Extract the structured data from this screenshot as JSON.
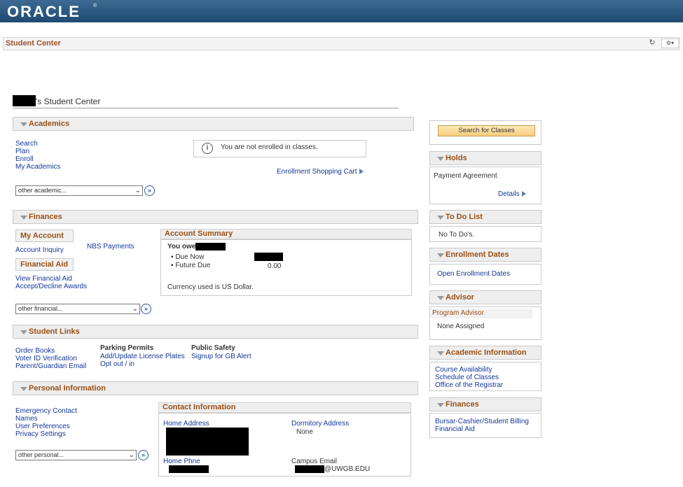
{
  "brand": {
    "logo": "ORACLE",
    "logo_mark": "®"
  },
  "page": {
    "title": "Student Center",
    "student_center_suffix": "'s Student Center"
  },
  "icons": {
    "refresh": "refresh-icon",
    "gear": "gear-icon"
  },
  "academics": {
    "header": "Academics",
    "links": [
      "Search",
      "Plan",
      "Enroll",
      "My Academics"
    ],
    "notice": "You are not enrolled in classes.",
    "cart_link": "Enrollment Shopping Cart",
    "select_value": "other academic..."
  },
  "finances": {
    "header": "Finances",
    "my_account": "My Account",
    "account_inquiry": "Account Inquiry",
    "nbs_payments": "NBS Payments",
    "financial_aid_header": "Financial Aid",
    "view_financial_aid": "View Financial Aid",
    "accept_decline": "Accept/Decline Awards",
    "select_value": "other financial...",
    "summary_header": "Account Summary",
    "you_owe": "You owe",
    "due_now": "Due Now",
    "future_due": "Future Due",
    "future_due_value": "0.00",
    "currency_note": "Currency used is US Dollar."
  },
  "student_links": {
    "header": "Student Links",
    "col1": [
      "Order Books",
      "Voter ID Verification",
      "Parent/Guardian Email"
    ],
    "parking_header": "Parking Permits",
    "parking_links": [
      "Add/Update License Plates",
      "Opt out / in"
    ],
    "safety_header": "Public Safety",
    "safety_links": [
      "Signup for GB Alert"
    ]
  },
  "personal": {
    "header": "Personal Information",
    "links": [
      "Emergency Contact",
      "Names",
      "User Preferences",
      "Privacy Settings"
    ],
    "select_value": "other personal...",
    "contact_header": "Contact Information",
    "home_address": "Home Address",
    "dorm_address": "Dormitory Address",
    "dorm_value": "None",
    "home_phone": "Home Phne",
    "campus_email": "Campus Email",
    "email_domain": "@UWGB.EDU"
  },
  "right": {
    "search_button": "Search for Classes",
    "holds_header": "Holds",
    "holds_item": "Payment Agreement",
    "holds_details": "Details",
    "todo_header": "To Do List",
    "todo_item": "No To Do's.",
    "enroll_dates_header": "Enrollment Dates",
    "enroll_dates_link": "Open Enrollment Dates",
    "advisor_header": "Advisor",
    "advisor_sub": "Program Advisor",
    "advisor_value": "None Assigned",
    "acad_info_header": "Academic Information",
    "acad_info_links": [
      "Course Availability",
      "Schedule of Classes",
      "Office of the Registrar"
    ],
    "fin_header": "Finances",
    "fin_links": [
      "Bursar-Cashier/Student Billing",
      "Financial Aid"
    ]
  }
}
